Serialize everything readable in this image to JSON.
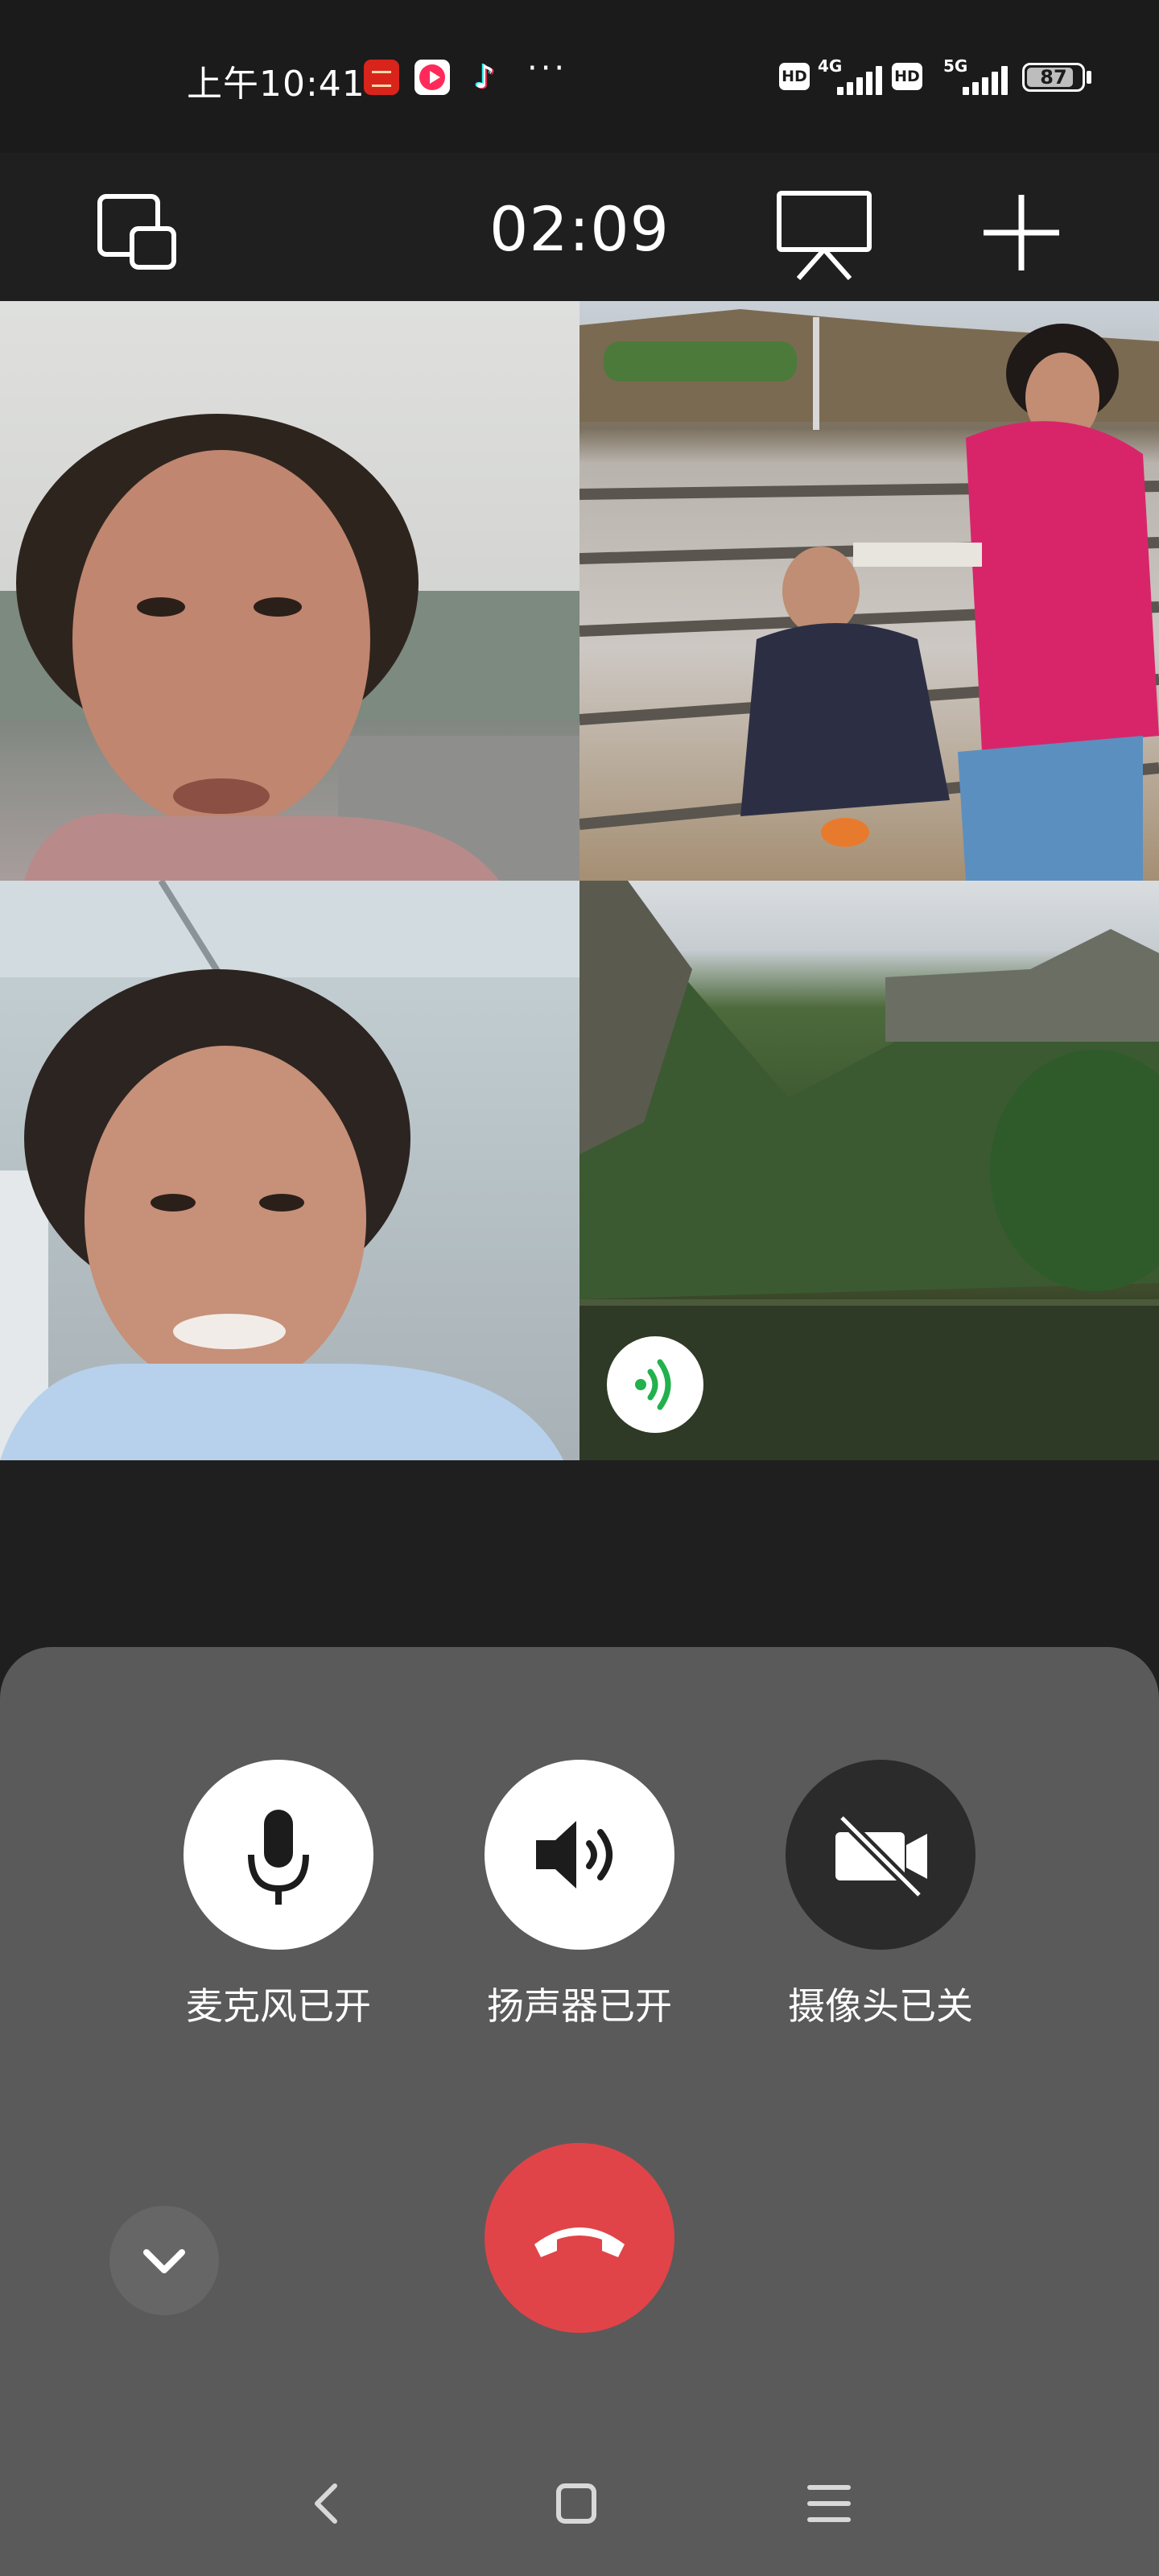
{
  "status_bar": {
    "time": "上午10:41",
    "app_icons": [
      "xuexi-app-icon",
      "video-app-icon",
      "tiktok-icon",
      "more-dots-icon"
    ],
    "hd_label": "HD",
    "network_1": "4G",
    "network_2": "5G",
    "battery": {
      "level": 87,
      "label": "87"
    }
  },
  "call_header": {
    "timer": "02:09",
    "icons": [
      "minimize-window-icon",
      "screen-share-icon",
      "add-participant-icon"
    ]
  },
  "participants": [
    {
      "label": "participant-1"
    },
    {
      "label": "participant-2"
    },
    {
      "label": "participant-3"
    },
    {
      "label": "participant-4",
      "speaking": true
    }
  ],
  "controls": {
    "mic": {
      "label": "麦克风已开",
      "icon": "microphone-icon",
      "state": "on"
    },
    "speaker": {
      "label": "扬声器已开",
      "icon": "speaker-icon",
      "state": "on"
    },
    "camera": {
      "label": "摄像头已关",
      "icon": "camera-off-icon",
      "state": "off"
    }
  },
  "colors": {
    "background": "#1f1f1f",
    "panel": "#5a5a5a",
    "active_button": "#ffffff",
    "inactive_button": "#2b2b2b",
    "hangup": "#e04448",
    "speaking_indicator": "#22b14c"
  },
  "nav_bar": {
    "icons": [
      "back-icon",
      "home-icon",
      "menu-icon"
    ]
  }
}
